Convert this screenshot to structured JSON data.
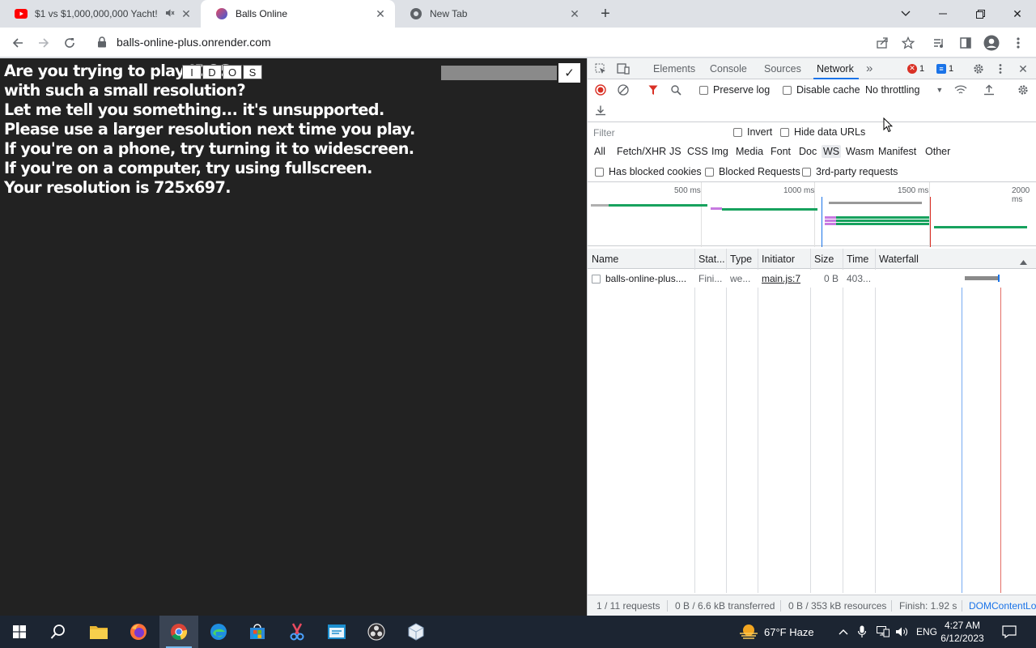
{
  "browser": {
    "tabs": [
      {
        "title": "$1 vs $1,000,000,000 Yacht!",
        "favicon": "youtube-icon",
        "muted": true,
        "active": false
      },
      {
        "title": "Balls Online",
        "favicon": "balls-online-icon",
        "active": true
      },
      {
        "title": "New Tab",
        "favicon": "chrome-icon",
        "active": false
      }
    ],
    "url": "balls-online-plus.onrender.com"
  },
  "page": {
    "message_lines": [
      "Are you trying to play IDOSe",
      "with such a small resolution?",
      "Let me tell you something... it's unsupported.",
      "Please use a larger resolution next time you play.",
      "If you're on a phone, try turning it to widescreen.",
      "If you're on a computer, try using fullscreen.",
      "Your resolution is 725x697."
    ],
    "keys": [
      "I",
      "D",
      "O",
      "S"
    ],
    "ok_label": "✓"
  },
  "devtools": {
    "tabs": [
      "Elements",
      "Console",
      "Sources",
      "Network"
    ],
    "selected_tab": "Network",
    "more": "»",
    "error_count": "1",
    "message_count": "1",
    "preserve_log": "Preserve log",
    "disable_cache": "Disable cache",
    "throttling": "No throttling",
    "filter_placeholder": "Filter",
    "invert": "Invert",
    "hide_data_urls": "Hide data URLs",
    "type_filters": [
      "All",
      "Fetch/XHR",
      "JS",
      "CSS",
      "Img",
      "Media",
      "Font",
      "Doc",
      "WS",
      "Wasm",
      "Manifest",
      "Other"
    ],
    "selected_type": "WS",
    "has_blocked_cookies": "Has blocked cookies",
    "blocked_requests": "Blocked Requests",
    "third_party": "3rd-party requests",
    "overview_ticks": [
      "500 ms",
      "1000 ms",
      "1500 ms",
      "2000 ms"
    ],
    "columns": [
      "Name",
      "Stat...",
      "Type",
      "Initiator",
      "Size",
      "Time",
      "Waterfall"
    ],
    "requests": [
      {
        "name": "balls-online-plus....",
        "status": "Fini...",
        "type": "we...",
        "initiator": "main.js:7",
        "size": "0 B",
        "time": "403..."
      }
    ],
    "status": {
      "requests": "1 / 11 requests",
      "transferred": "0 B / 6.6 kB transferred",
      "resources": "0 B / 353 kB resources",
      "finish": "Finish: 1.92 s",
      "domcontent": "DOMContentLo"
    }
  },
  "taskbar": {
    "weather": "67°F  Haze",
    "language": "ENG",
    "time": "4:27 AM",
    "date": "6/12/2023"
  }
}
